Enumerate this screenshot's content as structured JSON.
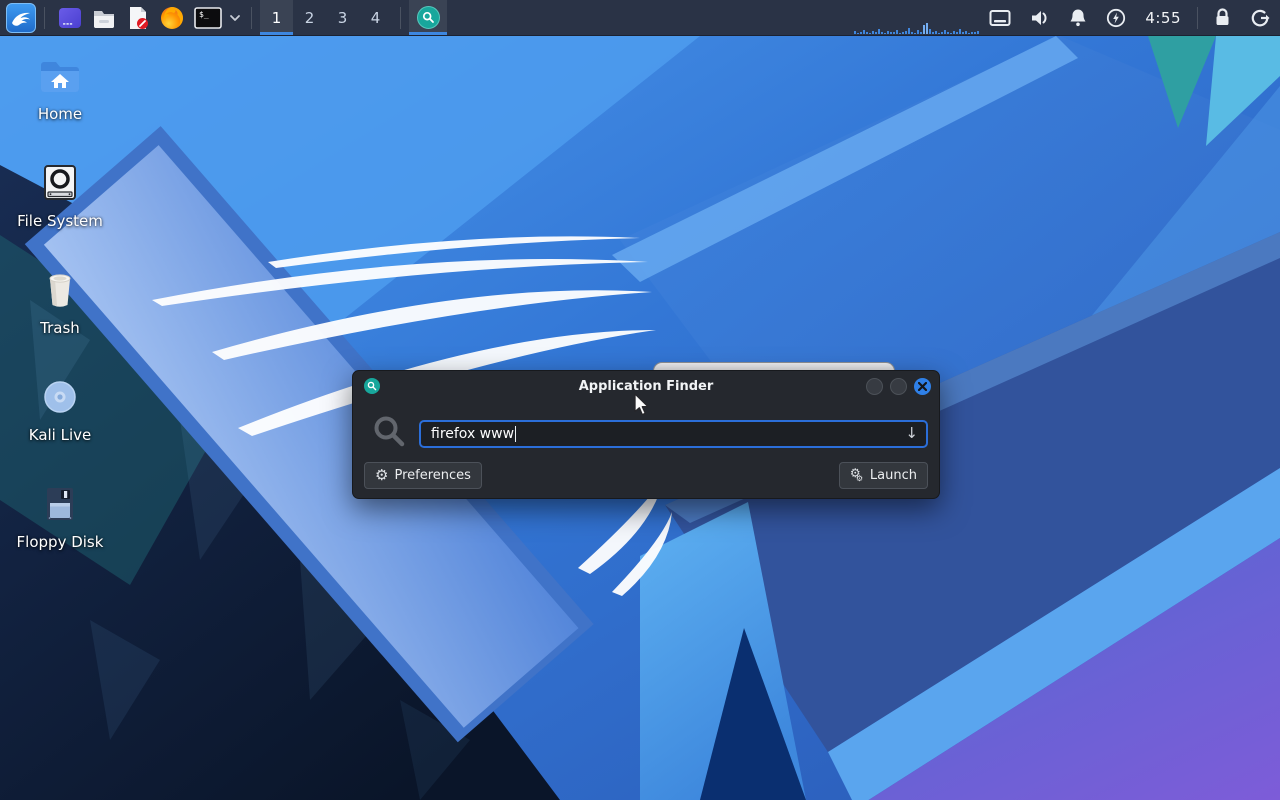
{
  "panel": {
    "workspaces": {
      "items": [
        "1",
        "2",
        "3",
        "4"
      ],
      "active_index": 0
    },
    "clock": "4:55",
    "terminal_label": "$_",
    "graph_bars": [
      3,
      1,
      2,
      4,
      2,
      1,
      3,
      2,
      5,
      2,
      1,
      3,
      2,
      2,
      4,
      1,
      2,
      3,
      6,
      2,
      1,
      4,
      2,
      9,
      11,
      5,
      2,
      3,
      1,
      2,
      4,
      2,
      1,
      3,
      2,
      5,
      2,
      3,
      1,
      2,
      2,
      3
    ],
    "icon_names": [
      "kali-menu",
      "window-switcher",
      "file-manager",
      "text-editor",
      "firefox",
      "terminal",
      "workspace-pager",
      "app-finder",
      "display",
      "volume",
      "notifications",
      "power-manager",
      "clock",
      "lock",
      "logout"
    ]
  },
  "desktop": {
    "icons": [
      {
        "label": "Home"
      },
      {
        "label": "File System"
      },
      {
        "label": "Trash"
      },
      {
        "label": "Kali Live"
      },
      {
        "label": "Floppy Disk"
      }
    ]
  },
  "finder": {
    "title": "Application Finder",
    "search": {
      "value": "firefox www",
      "dropdown_arrow": "↓"
    },
    "buttons": {
      "preferences": "Preferences",
      "launch": "Launch"
    },
    "icons": {
      "gear": "⚙",
      "launch_gear_big": "⚙",
      "launch_gear_small": "⚙"
    }
  },
  "colors": {
    "accent_blue": "#2b6ed9",
    "panel_bg": "#2a3346",
    "dialog_bg": "#25282e",
    "close_button": "#2f80e8",
    "teal_icon": "#18a79c",
    "active_underline": "#3d87e0",
    "wallpaper_dark": "#0c1830",
    "wallpaper_purple": "#7a5ed6"
  }
}
